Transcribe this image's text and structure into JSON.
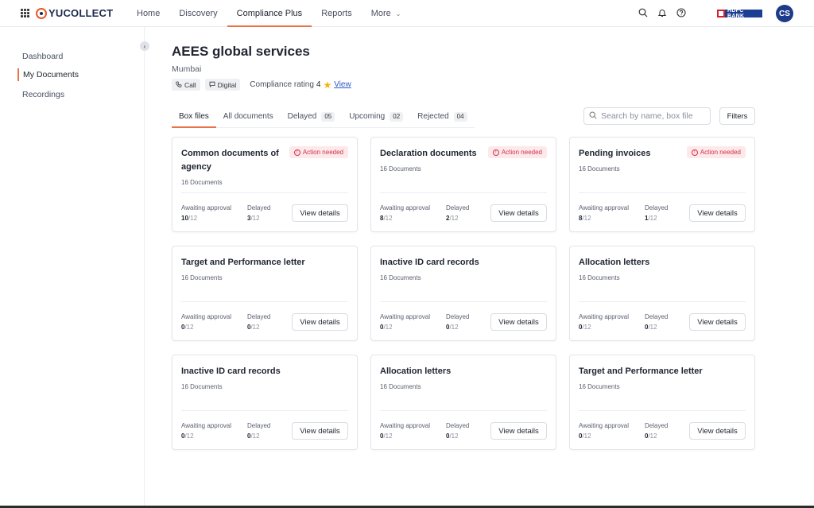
{
  "brand": {
    "name": "YUCOLLECT"
  },
  "nav": [
    {
      "label": "Home"
    },
    {
      "label": "Discovery"
    },
    {
      "label": "Compliance Plus",
      "active": true
    },
    {
      "label": "Reports"
    },
    {
      "label": "More",
      "dropdown": true
    }
  ],
  "topbar": {
    "icons": [
      "search-icon",
      "bell-icon",
      "help-icon"
    ],
    "bank_logo_text": "HDFC BANK",
    "avatar_initials": "CS"
  },
  "sidebar": {
    "items": [
      {
        "label": "Dashboard"
      },
      {
        "label": "My Documents",
        "active": true
      },
      {
        "label": "Recordings"
      }
    ]
  },
  "agency": {
    "name": "AEES global services",
    "city": "Mumbai",
    "channels": [
      {
        "label": "Call",
        "icon": "phone-icon"
      },
      {
        "label": "Digital",
        "icon": "chat-icon"
      }
    ],
    "rating_label": "Compliance rating",
    "rating_value": "4",
    "view_label": "View"
  },
  "tabs": [
    {
      "label": "Box files",
      "active": true,
      "count": ""
    },
    {
      "label": "All documents",
      "count": ""
    },
    {
      "label": "Delayed",
      "count": "05"
    },
    {
      "label": "Upcoming",
      "count": "02"
    },
    {
      "label": "Rejected",
      "count": "04"
    }
  ],
  "search": {
    "placeholder": "Search by name, box file"
  },
  "filters_label": "Filters",
  "card_labels": {
    "awaiting": "Awaiting approval",
    "delayed": "Delayed",
    "view": "View details",
    "action": "Action needed"
  },
  "colors": {
    "accent": "#e8734a",
    "badge_bg": "#fde8ea",
    "badge_text": "#d0334a",
    "avatar": "#1e3a8a"
  },
  "cards": [
    {
      "title": "Common documents of agency",
      "documents": "16 Documents",
      "action_needed": true,
      "awaiting": "10",
      "awaiting_total": "/12",
      "delayed": "3",
      "delayed_total": "/12"
    },
    {
      "title": "Declaration documents",
      "documents": "16 Documents",
      "action_needed": true,
      "awaiting": "8",
      "awaiting_total": "/12",
      "delayed": "2",
      "delayed_total": "/12"
    },
    {
      "title": "Pending invoices",
      "documents": "16 Documents",
      "action_needed": true,
      "awaiting": "8",
      "awaiting_total": "/12",
      "delayed": "1",
      "delayed_total": "/12"
    },
    {
      "title": "Target and Performance letter",
      "documents": "16 Documents",
      "action_needed": false,
      "awaiting": "0",
      "awaiting_total": "/12",
      "delayed": "0",
      "delayed_total": "/12"
    },
    {
      "title": "Inactive ID card records",
      "documents": "16 Documents",
      "action_needed": false,
      "awaiting": "0",
      "awaiting_total": "/12",
      "delayed": "0",
      "delayed_total": "/12"
    },
    {
      "title": "Allocation letters",
      "documents": "16 Documents",
      "action_needed": false,
      "awaiting": "0",
      "awaiting_total": "/12",
      "delayed": "0",
      "delayed_total": "/12"
    },
    {
      "title": "Inactive ID card records",
      "documents": "16 Documents",
      "action_needed": false,
      "awaiting": "0",
      "awaiting_total": "/12",
      "delayed": "0",
      "delayed_total": "/12"
    },
    {
      "title": "Allocation letters",
      "documents": "16 Documents",
      "action_needed": false,
      "awaiting": "0",
      "awaiting_total": "/12",
      "delayed": "0",
      "delayed_total": "/12"
    },
    {
      "title": "Target and Performance letter",
      "documents": "16 Documents",
      "action_needed": false,
      "awaiting": "0",
      "awaiting_total": "/12",
      "delayed": "0",
      "delayed_total": "/12"
    }
  ]
}
